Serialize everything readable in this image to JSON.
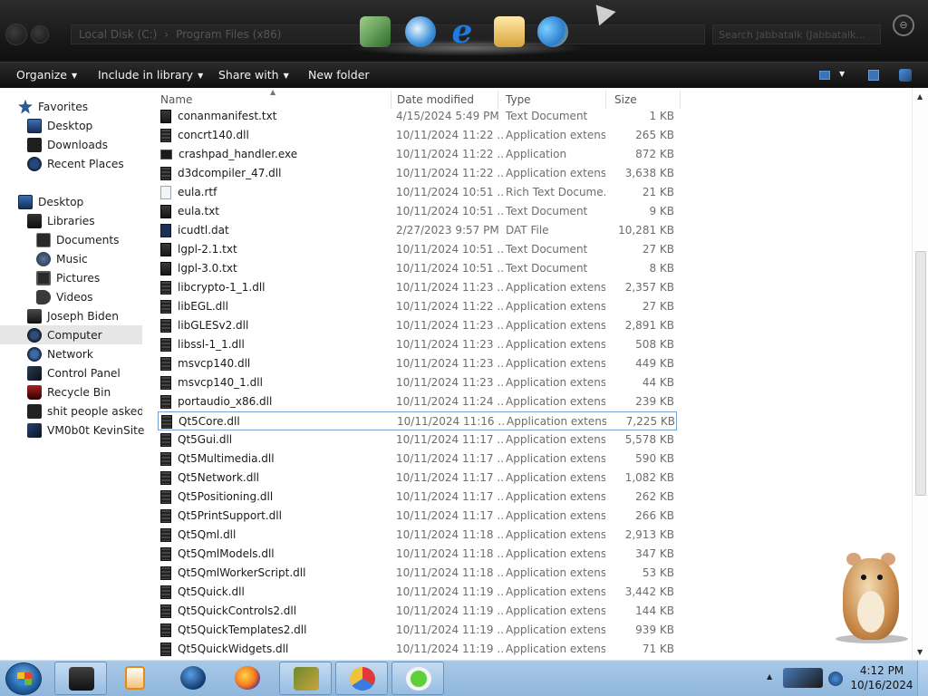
{
  "window": {
    "address": [
      "Local Disk (C:)",
      "Program Files (x86)"
    ],
    "search_placeholder": "Search Jabbatalk (Jabbatalk...",
    "dock_icons": [
      "app-grid-icon",
      "internet-download-icon",
      "internet-explorer-icon",
      "mail-icon",
      "users-icon"
    ]
  },
  "toolbar": {
    "organize": "Organize",
    "include_in_library": "Include in library",
    "share_with": "Share with",
    "new_folder": "New folder"
  },
  "nav": {
    "favorites": "Favorites",
    "desktop_fav": "Desktop",
    "downloads": "Downloads",
    "recent_places": "Recent Places",
    "desktop": "Desktop",
    "libraries": "Libraries",
    "documents": "Documents",
    "music": "Music",
    "pictures": "Pictures",
    "videos": "Videos",
    "user": "Joseph Biden",
    "computer": "Computer",
    "network": "Network",
    "control_panel": "Control Panel",
    "recycle_bin": "Recycle Bin",
    "folder_1": "shit people asked me",
    "folder_2": "VM0b0t KevinSite"
  },
  "columns": {
    "name": "Name",
    "date_modified": "Date modified",
    "type": "Type",
    "size": "Size"
  },
  "files": [
    {
      "name": "conanmanifest.txt",
      "date": "4/15/2024 5:49 PM",
      "type": "Text Document",
      "size": "1 KB",
      "icon": "txt"
    },
    {
      "name": "concrt140.dll",
      "date": "10/11/2024 11:22 ...",
      "type": "Application extens...",
      "size": "265 KB",
      "icon": "dll"
    },
    {
      "name": "crashpad_handler.exe",
      "date": "10/11/2024 11:22 ...",
      "type": "Application",
      "size": "872 KB",
      "icon": "exe"
    },
    {
      "name": "d3dcompiler_47.dll",
      "date": "10/11/2024 11:22 ...",
      "type": "Application extens...",
      "size": "3,638 KB",
      "icon": "dll"
    },
    {
      "name": "eula.rtf",
      "date": "10/11/2024 10:51 ...",
      "type": "Rich Text Docume...",
      "size": "21 KB",
      "icon": "rtf"
    },
    {
      "name": "eula.txt",
      "date": "10/11/2024 10:51 ...",
      "type": "Text Document",
      "size": "9 KB",
      "icon": "txt"
    },
    {
      "name": "icudtl.dat",
      "date": "2/27/2023 9:57 PM",
      "type": "DAT File",
      "size": "10,281 KB",
      "icon": "dat"
    },
    {
      "name": "lgpl-2.1.txt",
      "date": "10/11/2024 10:51 ...",
      "type": "Text Document",
      "size": "27 KB",
      "icon": "txt"
    },
    {
      "name": "lgpl-3.0.txt",
      "date": "10/11/2024 10:51 ...",
      "type": "Text Document",
      "size": "8 KB",
      "icon": "txt"
    },
    {
      "name": "libcrypto-1_1.dll",
      "date": "10/11/2024 11:23 ...",
      "type": "Application extens...",
      "size": "2,357 KB",
      "icon": "dll"
    },
    {
      "name": "libEGL.dll",
      "date": "10/11/2024 11:22 ...",
      "type": "Application extens...",
      "size": "27 KB",
      "icon": "dll"
    },
    {
      "name": "libGLESv2.dll",
      "date": "10/11/2024 11:23 ...",
      "type": "Application extens...",
      "size": "2,891 KB",
      "icon": "dll"
    },
    {
      "name": "libssl-1_1.dll",
      "date": "10/11/2024 11:23 ...",
      "type": "Application extens...",
      "size": "508 KB",
      "icon": "dll"
    },
    {
      "name": "msvcp140.dll",
      "date": "10/11/2024 11:23 ...",
      "type": "Application extens...",
      "size": "449 KB",
      "icon": "dll"
    },
    {
      "name": "msvcp140_1.dll",
      "date": "10/11/2024 11:23 ...",
      "type": "Application extens...",
      "size": "44 KB",
      "icon": "dll"
    },
    {
      "name": "portaudio_x86.dll",
      "date": "10/11/2024 11:24 ...",
      "type": "Application extens...",
      "size": "239 KB",
      "icon": "dll"
    },
    {
      "name": "Qt5Core.dll",
      "date": "10/11/2024 11:16 ...",
      "type": "Application extens...",
      "size": "7,225 KB",
      "icon": "dll",
      "selected": true
    },
    {
      "name": "Qt5Gui.dll",
      "date": "10/11/2024 11:17 ...",
      "type": "Application extens...",
      "size": "5,578 KB",
      "icon": "dll"
    },
    {
      "name": "Qt5Multimedia.dll",
      "date": "10/11/2024 11:17 ...",
      "type": "Application extens...",
      "size": "590 KB",
      "icon": "dll"
    },
    {
      "name": "Qt5Network.dll",
      "date": "10/11/2024 11:17 ...",
      "type": "Application extens...",
      "size": "1,082 KB",
      "icon": "dll"
    },
    {
      "name": "Qt5Positioning.dll",
      "date": "10/11/2024 11:17 ...",
      "type": "Application extens...",
      "size": "262 KB",
      "icon": "dll"
    },
    {
      "name": "Qt5PrintSupport.dll",
      "date": "10/11/2024 11:17 ...",
      "type": "Application extens...",
      "size": "266 KB",
      "icon": "dll"
    },
    {
      "name": "Qt5Qml.dll",
      "date": "10/11/2024 11:18 ...",
      "type": "Application extens...",
      "size": "2,913 KB",
      "icon": "dll"
    },
    {
      "name": "Qt5QmlModels.dll",
      "date": "10/11/2024 11:18 ...",
      "type": "Application extens...",
      "size": "347 KB",
      "icon": "dll"
    },
    {
      "name": "Qt5QmlWorkerScript.dll",
      "date": "10/11/2024 11:18 ...",
      "type": "Application extens...",
      "size": "53 KB",
      "icon": "dll"
    },
    {
      "name": "Qt5Quick.dll",
      "date": "10/11/2024 11:19 ...",
      "type": "Application extens...",
      "size": "3,442 KB",
      "icon": "dll"
    },
    {
      "name": "Qt5QuickControls2.dll",
      "date": "10/11/2024 11:19 ...",
      "type": "Application extens...",
      "size": "144 KB",
      "icon": "dll"
    },
    {
      "name": "Qt5QuickTemplates2.dll",
      "date": "10/11/2024 11:19 ...",
      "type": "Application extens...",
      "size": "939 KB",
      "icon": "dll"
    },
    {
      "name": "Qt5QuickWidgets.dll",
      "date": "10/11/2024 11:19 ...",
      "type": "Application extens...",
      "size": "71 KB",
      "icon": "dll"
    }
  ],
  "taskbar": {
    "apps": [
      "windows-explorer-icon",
      "media-player-icon",
      "google-earth-icon",
      "firefox-icon",
      "box-game-icon",
      "picasa-icon",
      "cloud-upload-icon"
    ],
    "time": "4:12 PM",
    "date": "10/16/2024"
  }
}
